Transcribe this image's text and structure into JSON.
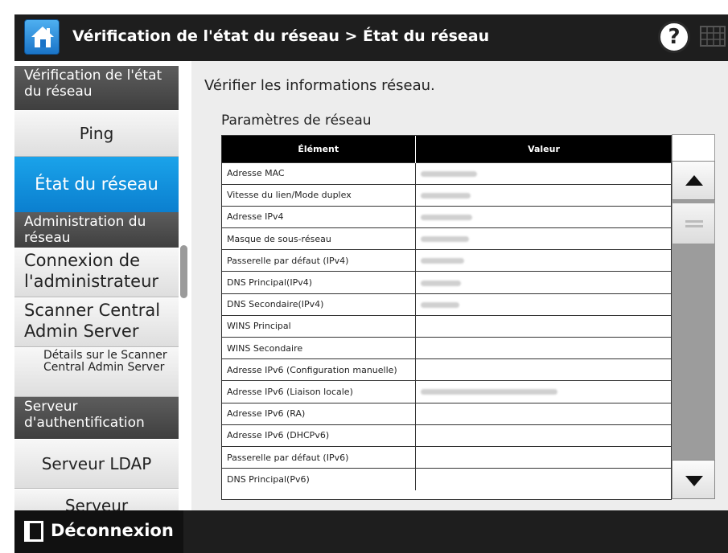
{
  "header": {
    "title": "Vérification de l'état du réseau > État du réseau",
    "help_label": "?"
  },
  "sidebar": {
    "items": [
      {
        "label": "Vérification de l'état du réseau",
        "type": "category"
      },
      {
        "label": "Ping",
        "type": "button"
      },
      {
        "label": "État du réseau",
        "type": "button",
        "selected": true
      },
      {
        "label": "Administration du réseau",
        "type": "category"
      },
      {
        "label": "Connexion de l'administrateur",
        "type": "button"
      },
      {
        "label": "Scanner Central Admin Server",
        "type": "button"
      },
      {
        "label": "Détails sur le Scanner Central Admin Server",
        "type": "button"
      },
      {
        "label": "Serveur d'authentification",
        "type": "category"
      },
      {
        "label": "Serveur LDAP",
        "type": "button"
      },
      {
        "label": "Serveur",
        "type": "button"
      }
    ]
  },
  "main": {
    "intro": "Vérifier les informations réseau.",
    "section_title": "Paramètres de réseau",
    "table": {
      "headers": [
        "Élément",
        "Valeur"
      ],
      "rows": [
        {
          "label": "Adresse MAC",
          "has_value": true
        },
        {
          "label": "Vitesse du lien/Mode duplex",
          "has_value": true
        },
        {
          "label": "Adresse IPv4",
          "has_value": true
        },
        {
          "label": "Masque de sous-réseau",
          "has_value": true
        },
        {
          "label": "Passerelle par défaut (IPv4)",
          "has_value": true
        },
        {
          "label": "DNS Principal(IPv4)",
          "has_value": true
        },
        {
          "label": "DNS Secondaire(IPv4)",
          "has_value": true
        },
        {
          "label": "WINS Principal",
          "has_value": false
        },
        {
          "label": "WINS Secondaire",
          "has_value": false
        },
        {
          "label": "Adresse IPv6 (Configuration manuelle)",
          "has_value": false
        },
        {
          "label": "Adresse IPv6 (Liaison locale)",
          "has_value": true
        },
        {
          "label": "Adresse IPv6 (RA)",
          "has_value": false
        },
        {
          "label": "Adresse IPv6 (DHCPv6)",
          "has_value": false
        },
        {
          "label": "Passerelle par défaut (IPv6)",
          "has_value": false
        },
        {
          "label": "DNS Principal(Pv6)",
          "has_value": false
        }
      ]
    }
  },
  "footer": {
    "logout_label": "Déconnexion"
  },
  "colors": {
    "header_bg": "#1e1e1e",
    "accent_blue": "#0b7fcf",
    "category_bg": "#4a4a4a",
    "content_bg": "#ededed"
  },
  "icons": {
    "home": "home-icon",
    "help": "help-icon",
    "keyboard": "keyboard-icon",
    "scroll_up": "triangle-up-icon",
    "scroll_down": "triangle-down-icon",
    "logout": "logout-icon"
  }
}
